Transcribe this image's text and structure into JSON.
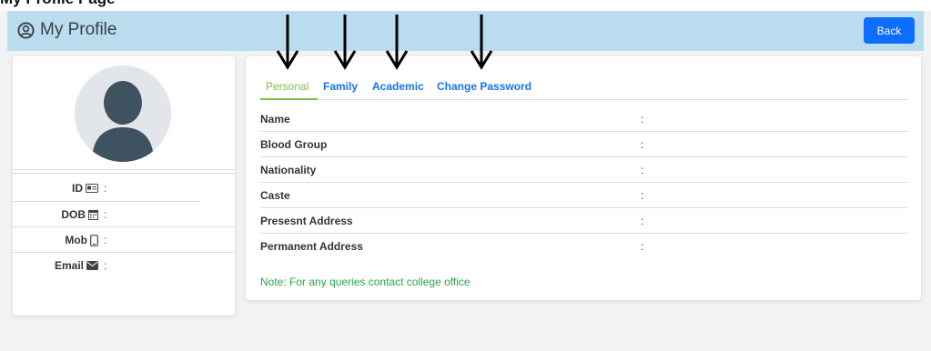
{
  "app": {
    "title": "My Profile",
    "back_label": "Back",
    "top_strip_text": "My Profile Page"
  },
  "sidebar": {
    "fields": [
      {
        "label": "ID",
        "icon": "id-card-icon",
        "colon": ":"
      },
      {
        "label": "DOB",
        "icon": "calendar-icon",
        "colon": ":"
      },
      {
        "label": "Mob",
        "icon": "mobile-icon",
        "colon": ":"
      },
      {
        "label": "Email",
        "icon": "envelope-icon",
        "colon": ":"
      }
    ]
  },
  "tabs": [
    {
      "label": "Personal",
      "active": true
    },
    {
      "label": "Family",
      "active": false
    },
    {
      "label": "Academic",
      "active": false
    },
    {
      "label": "Change Password",
      "active": false
    }
  ],
  "personal": {
    "rows": [
      {
        "label": "Name",
        "colon": ":",
        "value": ""
      },
      {
        "label": "Blood Group",
        "colon": ":",
        "value": ""
      },
      {
        "label": "Nationality",
        "colon": ":",
        "value": ""
      },
      {
        "label": "Caste",
        "colon": ":",
        "value": ""
      },
      {
        "label": "Presesnt Address",
        "colon": ":",
        "value": ""
      },
      {
        "label": "Permanent Address",
        "colon": ":",
        "value": ""
      }
    ]
  },
  "note": "Note: For any queries contact college office",
  "colors": {
    "header_bg": "#b9dcef",
    "back_button": "#0d6efd",
    "active_tab": "#7cc142",
    "tab_link": "#1a73e8",
    "note_text": "#28a745"
  }
}
